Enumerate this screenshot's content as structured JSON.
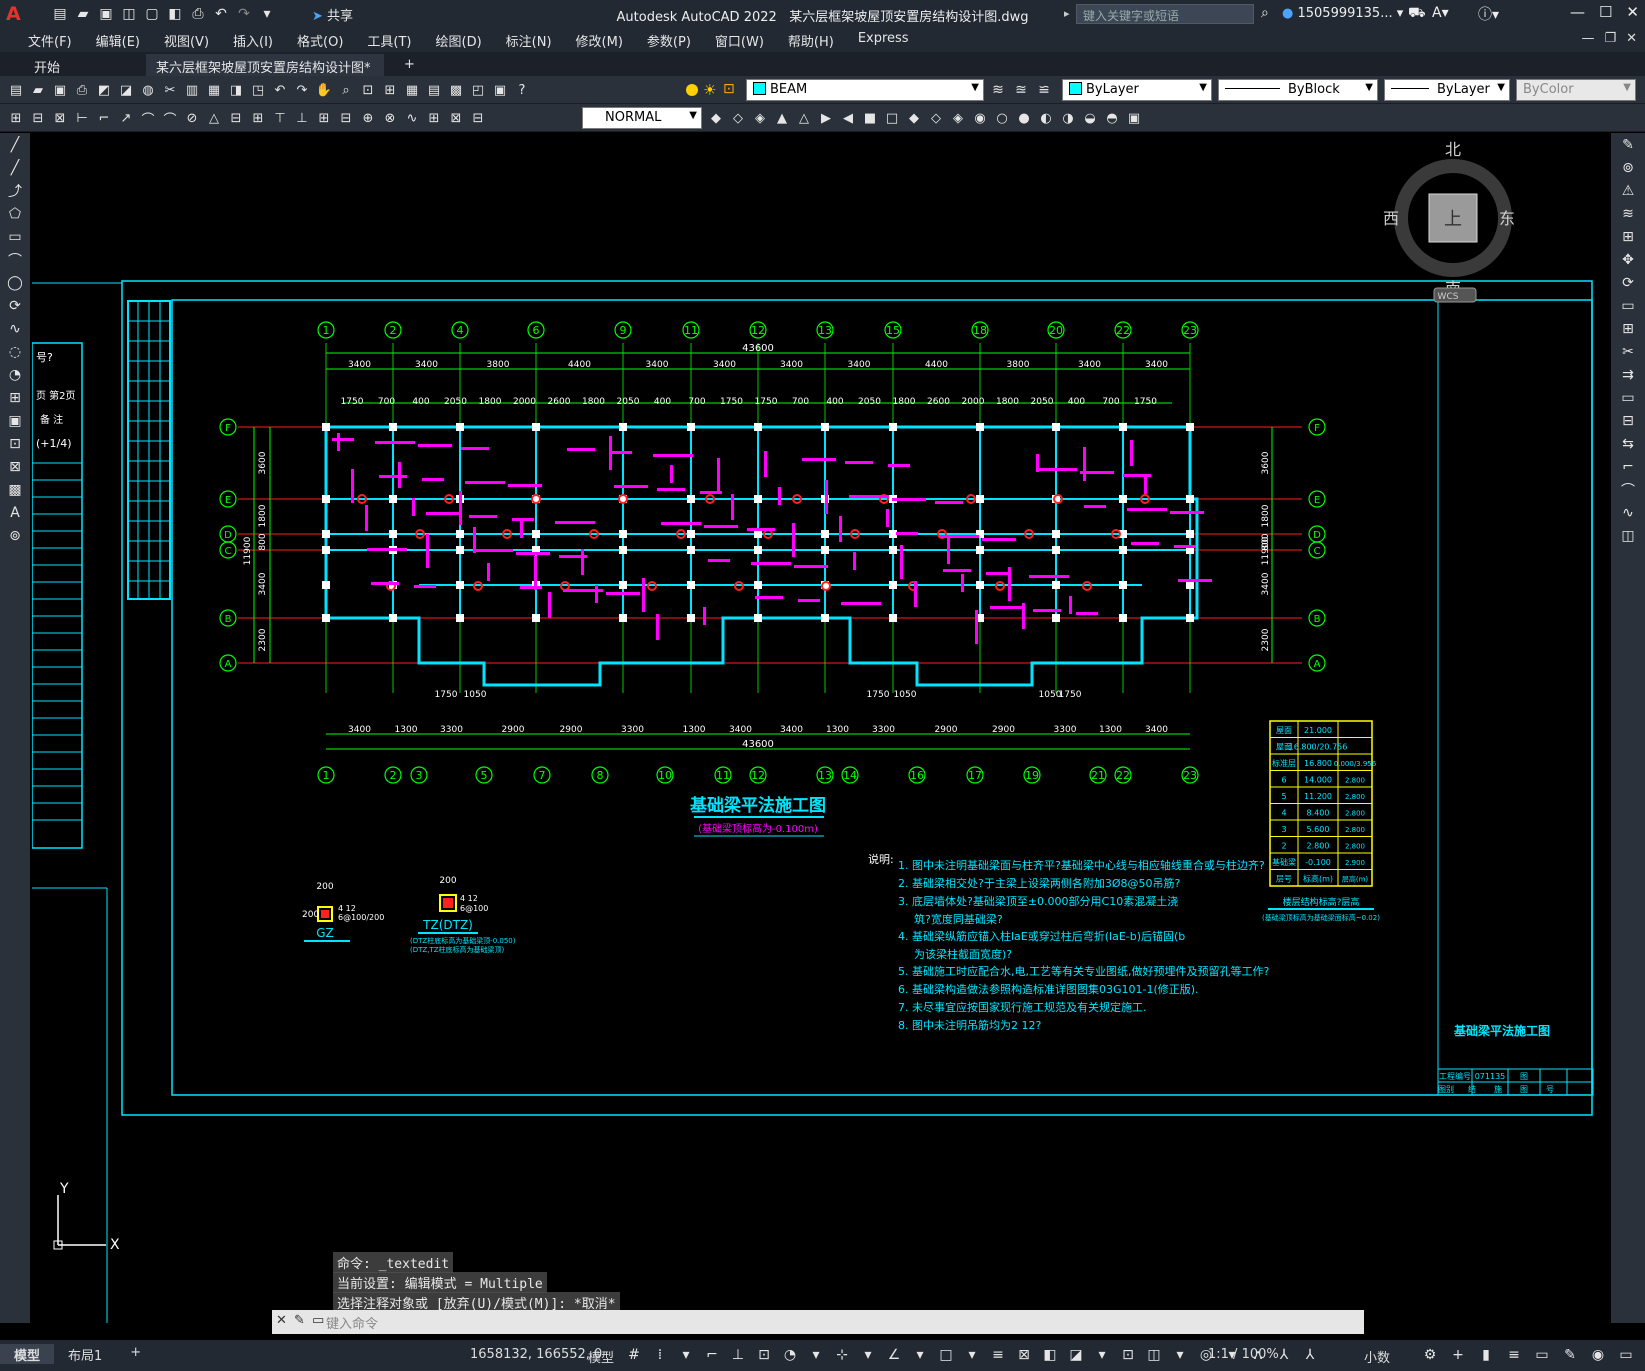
{
  "titlebar": {
    "app": "Autodesk AutoCAD 2022",
    "file": "某六层框架坡屋顶安置房结构设计图.dwg",
    "share": "共享",
    "search_placeholder": "键入关键字或短语",
    "user": "1505999135..."
  },
  "menu": [
    "文件(F)",
    "编辑(E)",
    "视图(V)",
    "插入(I)",
    "格式(O)",
    "工具(T)",
    "绘图(D)",
    "标注(N)",
    "修改(M)",
    "参数(P)",
    "窗口(W)",
    "帮助(H)",
    "Express"
  ],
  "tabs": [
    {
      "label": "开始"
    },
    {
      "label": "某六层框架坡屋顶安置房结构设计图*"
    }
  ],
  "toolbar": {
    "layer": "BEAM",
    "color": "ByLayer",
    "linetype": "ByBlock",
    "lineweight": "ByLayer",
    "plotstyle": "ByColor",
    "textstyle": "NORMAL"
  },
  "compass": {
    "north": "北",
    "south": "南",
    "east": "东",
    "west": "西",
    "top": "上",
    "wcs": "WCS"
  },
  "drawing": {
    "title": "基础梁平法施工图",
    "subtitle": "(基础梁顶标高为-0.100m)",
    "total_dim": "43600",
    "axis_top": [
      "1",
      "2",
      "4",
      "6",
      "9",
      "11",
      "12",
      "13",
      "15",
      "18",
      "20",
      "22",
      "23"
    ],
    "axis_bottom": [
      "1",
      "2",
      "3",
      "5",
      "7",
      "8",
      "10",
      "11",
      "12",
      "13",
      "14",
      "16",
      "17",
      "19",
      "21",
      "22",
      "23"
    ],
    "axis_rows": [
      "F",
      "E",
      "D",
      "C",
      "B",
      "A"
    ],
    "dims_top": [
      "3400",
      "3400",
      "3800",
      "4400",
      "3400",
      "3400",
      "3400",
      "3400",
      "4400",
      "3800",
      "3400",
      "3400"
    ],
    "dims_top2": [
      "1750",
      "700",
      "400",
      "2050",
      "1800",
      "2000",
      "2600",
      "1800",
      "2050",
      "400",
      "700",
      "1750",
      "1750",
      "700",
      "400",
      "2050",
      "1800",
      "2600",
      "2000",
      "1800",
      "2050",
      "400",
      "700",
      "1750"
    ],
    "dims_bottom": [
      "3400",
      "1300",
      "3300",
      "2900",
      "2900",
      "3300",
      "1300",
      "3400",
      "3400",
      "1300",
      "3300",
      "2900",
      "2900",
      "3300",
      "1300",
      "3400"
    ],
    "dims_bottom2": [
      "1750",
      "1050",
      "1750",
      "1050",
      "1050",
      "1750"
    ],
    "side_dims_left": [
      "3600",
      "1800",
      "800",
      "3400",
      "2300",
      "11900"
    ],
    "notes_label": "说明:",
    "notes": [
      "1. 图中未注明基础梁面与柱齐平?基础梁中心线与相应轴线重合或与柱边齐?",
      "2. 基础梁相交处?于主梁上设梁两侧各附加3Ø8@50吊筋?",
      "3. 底层墙体处?基础梁顶至±0.000部分用C10素混凝土浇",
      "筑?宽度同基础梁?",
      "4. 基础梁纵筋应锚入柱laE或穿过柱后弯折(laE-b)后锚固(b",
      "为该梁柱截面宽度)?",
      "5. 基础施工时应配合水,电,工艺等有关专业图纸,做好预埋件及预留孔等工作?",
      "6. 基础梁构造做法参照构造标准详图图集03G101-1(修正版).",
      "7. 未尽事宜应按国家现行施工规范及有关规定施工.",
      "8. 图中未注明吊筋均为2 12?"
    ],
    "gz_label": "GZ",
    "gz_dims": [
      "200",
      "200",
      "4 12",
      "6@100/200"
    ],
    "tz_label": "TZ(DTZ)",
    "tz_dims": [
      "200",
      "4 12",
      "6@100"
    ],
    "tz_note": [
      "(DTZ柱底标高为基础梁顶-0.050)",
      "(DTZ,TZ柱底标高为基础梁顶)"
    ],
    "elev_table": [
      [
        "屋面",
        "21.000",
        ""
      ],
      [
        "屋面",
        "16.800/20.756",
        ""
      ],
      [
        "标准层",
        "16.800",
        "0.000/3.956"
      ],
      [
        "6",
        "14.000",
        "2.800"
      ],
      [
        "5",
        "11.200",
        "2.800"
      ],
      [
        "4",
        "8.400",
        "2.800"
      ],
      [
        "3",
        "5.600",
        "2.800"
      ],
      [
        "2",
        "2.800",
        "2.800"
      ],
      [
        "基础梁",
        "-0.100",
        "2.900"
      ],
      [
        "层号",
        "标高(m)",
        "层高(m)"
      ]
    ],
    "elev_caption": "楼层结构标高?层高",
    "elev_sub": "(基础梁顶标高为基础梁面标高~0.02)",
    "side_title": "基础梁平法施工图",
    "left_table": [
      "号?",
      "页 第2页",
      "备 注",
      "(+1/4)"
    ],
    "tb_proj": [
      "工程编号",
      "071135",
      "图"
    ],
    "tb_row2": [
      "图别",
      "结",
      "施",
      "图",
      "号"
    ]
  },
  "command": {
    "history": [
      "命令: _textedit",
      "当前设置: 编辑模式 = Multiple",
      "选择注释对象或 [放弃(U)/模式(M)]: *取消*"
    ],
    "placeholder": "键入命令"
  },
  "status": {
    "model_tab": "模型",
    "layout_tab": "布局1",
    "coords": "1658132, 166552, 0",
    "model": "模型",
    "scale": "1:1 / 100%",
    "units": "小数"
  },
  "ucs": {
    "y": "Y",
    "x": "X"
  }
}
